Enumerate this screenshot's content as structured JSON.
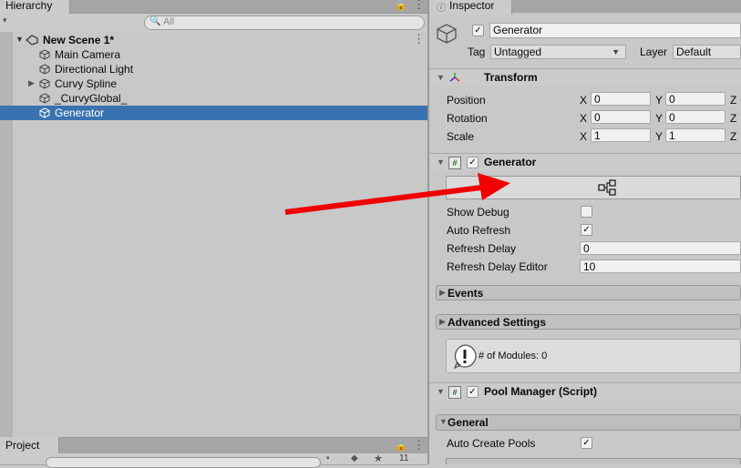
{
  "hierarchy": {
    "tab_label": "Hierarchy",
    "search_placeholder": "All",
    "scene_name": "New Scene 1*",
    "items": [
      {
        "label": "Main Camera"
      },
      {
        "label": "Directional Light"
      },
      {
        "label": "Curvy Spline"
      },
      {
        "label": "_CurvyGlobal_"
      },
      {
        "label": "Generator"
      }
    ]
  },
  "project": {
    "tab_label": "Project",
    "count": "11"
  },
  "inspector": {
    "tab_label": "Inspector",
    "object_name": "Generator",
    "tag_label": "Tag",
    "tag_value": "Untagged",
    "layer_label": "Layer",
    "layer_value": "Default",
    "transform": {
      "title": "Transform",
      "rows": [
        {
          "label": "Position",
          "x": "0",
          "y": "0"
        },
        {
          "label": "Rotation",
          "x": "0",
          "y": "0"
        },
        {
          "label": "Scale",
          "x": "1",
          "y": "1"
        }
      ],
      "x_label": "X",
      "y_label": "Y",
      "z_label": "Z"
    },
    "generator": {
      "title": "Generator",
      "show_debug_label": "Show Debug",
      "auto_refresh_label": "Auto Refresh",
      "refresh_delay_label": "Refresh Delay",
      "refresh_delay_value": "0",
      "refresh_delay_editor_label": "Refresh Delay Editor",
      "refresh_delay_editor_value": "10",
      "events_label": "Events",
      "advanced_label": "Advanced Settings",
      "modules_info": "# of Modules: 0"
    },
    "pool_manager": {
      "title": "Pool Manager (Script)",
      "general_label": "General",
      "auto_create_pools_label": "Auto Create Pools"
    }
  },
  "colors": {
    "selection": "#3a72b0",
    "arrow": "#f00000"
  }
}
